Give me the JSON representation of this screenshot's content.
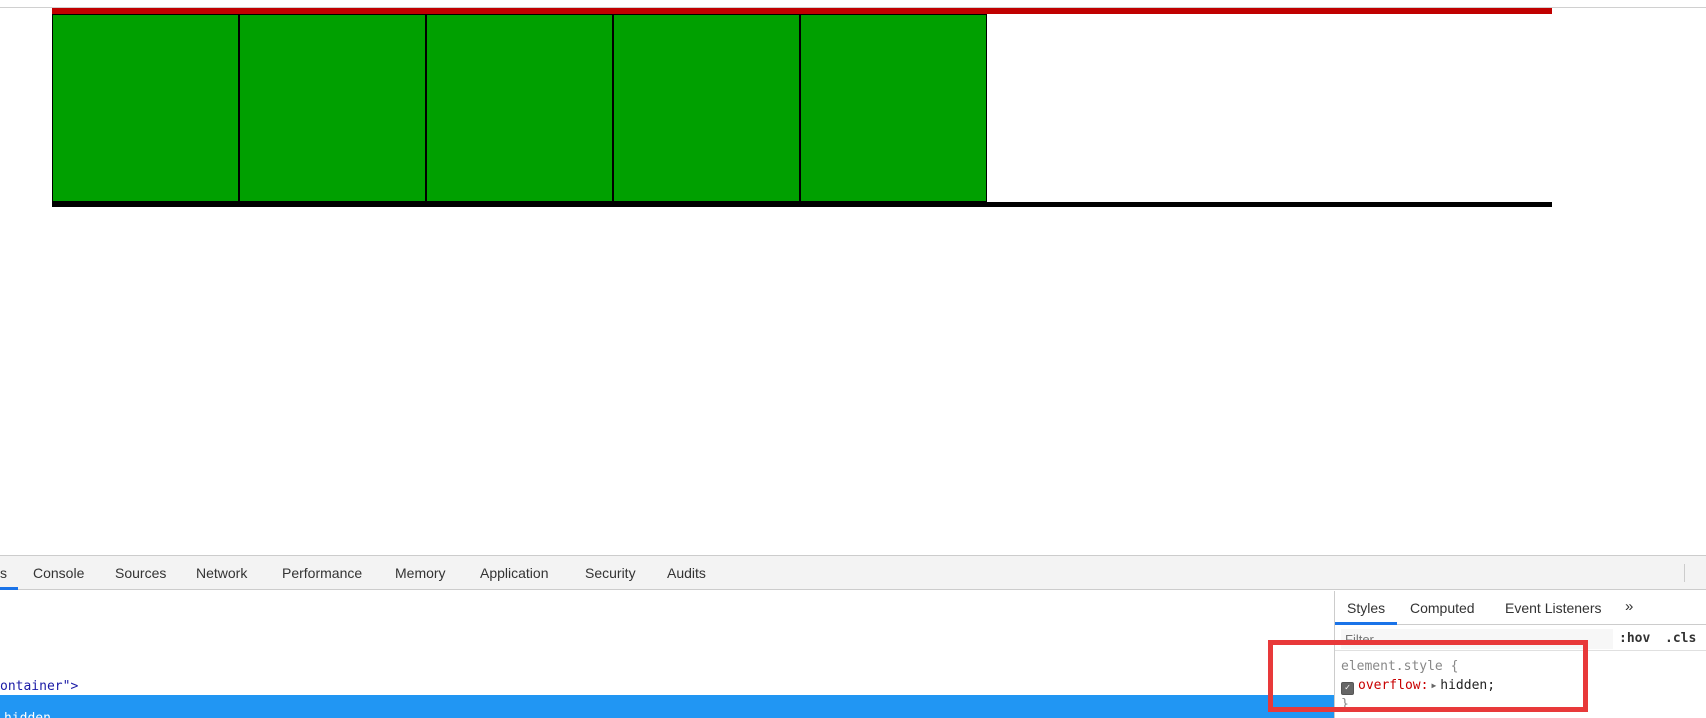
{
  "viewport": {
    "boxes": [
      "box-1",
      "box-2",
      "box-3",
      "box-4",
      "box-5"
    ],
    "colors": {
      "box_fill": "#00a000",
      "container_top_border": "#c00000",
      "container_bottom_border": "#000000"
    }
  },
  "devtools": {
    "tabs": {
      "elements_partial": "s",
      "console": "Console",
      "sources": "Sources",
      "network": "Network",
      "performance": "Performance",
      "memory": "Memory",
      "application": "Application",
      "security": "Security",
      "audits": "Audits"
    },
    "elements_panel": {
      "dom_line_text": "ontainer\">",
      "selected_line_text": "hidden"
    },
    "styles_panel": {
      "subtabs": {
        "styles": "Styles",
        "computed": "Computed",
        "event_listeners": "Event Listeners",
        "more": "»"
      },
      "filter_placeholder": "Filter",
      "hov": ":hov",
      "cls": ".cls",
      "rule": {
        "selector": "element.style {",
        "property": "overflow:",
        "value": "hidden;",
        "close": "}"
      }
    }
  },
  "annotation": {
    "color": "#e8393a"
  }
}
